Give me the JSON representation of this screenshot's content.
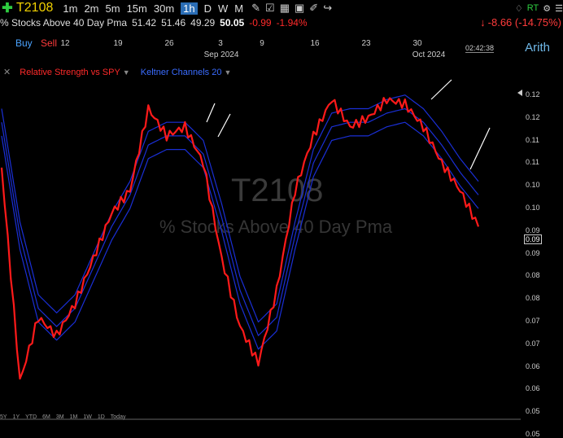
{
  "toolbar": {
    "symbol": "T2108",
    "timeframes": [
      "1m",
      "2m",
      "5m",
      "15m",
      "30m",
      "1h",
      "D",
      "W",
      "M"
    ],
    "active_timeframe": "1h",
    "rt_label": "RT"
  },
  "quote": {
    "title": "% Stocks Above 40 Day Pma",
    "open": "51.42",
    "high": "51.46",
    "low": "49.29",
    "last": "50.05",
    "change": "-0.99",
    "change_pct": "-1.94%",
    "right_change": "-8.66",
    "right_change_pct": "(-14.75%)"
  },
  "trade": {
    "buy": "Buy",
    "sell": "Sell"
  },
  "scale_mode": "Arith",
  "clock": "02:42:38",
  "date_axis": {
    "ticks": [
      "12",
      "19",
      "26",
      "3",
      "9",
      "16",
      "23",
      "30"
    ],
    "months": [
      "Sep 2024",
      "Oct 2024"
    ]
  },
  "legend": {
    "study1": "Relative Strength vs SPY",
    "study2": "Keltner Channels 20"
  },
  "watermark": {
    "symbol": "T2108",
    "description": "% Stocks Above 40 Day Pma"
  },
  "ranges": [
    "5Y",
    "1Y",
    "YTD",
    "6M",
    "3M",
    "1M",
    "1W",
    "1D",
    "Today"
  ],
  "colors": {
    "price": "#ff1a1a",
    "keltner": "#1a2fd6",
    "symbol": "#f0d000",
    "buy": "#4aa3ff",
    "sell": "#ff3b3b"
  },
  "chart_data": {
    "type": "line",
    "title": "% Stocks Above 40 Day Pma",
    "series": [
      {
        "name": "Relative Strength vs SPY",
        "x": [
          "Aug 7",
          "Aug 9",
          "Aug 12",
          "Aug 14",
          "Aug 16",
          "Aug 19",
          "Aug 21",
          "Aug 23",
          "Aug 26",
          "Aug 28",
          "Aug 30",
          "Sep 3",
          "Sep 5",
          "Sep 9",
          "Sep 11",
          "Sep 13",
          "Sep 16",
          "Sep 18",
          "Sep 20",
          "Sep 23",
          "Sep 25",
          "Sep 27",
          "Sep 30",
          "Oct 2",
          "Oct 4",
          "Oct 7",
          "Oct 9"
        ],
        "values": [
          0.105,
          0.058,
          0.072,
          0.068,
          0.075,
          0.085,
          0.095,
          0.1,
          0.118,
          0.112,
          0.114,
          0.106,
          0.085,
          0.07,
          0.062,
          0.078,
          0.1,
          0.112,
          0.12,
          0.114,
          0.116,
          0.12,
          0.119,
          0.114,
          0.106,
          0.1,
          0.092
        ]
      },
      {
        "name": "Keltner Channels 20",
        "x": [
          "Aug 7",
          "Aug 9",
          "Aug 12",
          "Aug 14",
          "Aug 16",
          "Aug 19",
          "Aug 21",
          "Aug 23",
          "Aug 26",
          "Aug 28",
          "Aug 30",
          "Sep 3",
          "Sep 5",
          "Sep 9",
          "Sep 11",
          "Sep 13",
          "Sep 16",
          "Sep 18",
          "Sep 20",
          "Sep 23",
          "Sep 25",
          "Sep 27",
          "Sep 30",
          "Oct 2",
          "Oct 4",
          "Oct 7",
          "Oct 9"
        ],
        "values": [
          0.115,
          0.09,
          0.074,
          0.07,
          0.074,
          0.083,
          0.092,
          0.099,
          0.11,
          0.112,
          0.112,
          0.108,
          0.094,
          0.078,
          0.068,
          0.072,
          0.09,
          0.106,
          0.114,
          0.115,
          0.115,
          0.117,
          0.118,
          0.115,
          0.11,
          0.104,
          0.099
        ]
      }
    ],
    "y_ticks": [
      "0.12",
      "0.12",
      "0.11",
      "0.11",
      "0.10",
      "0.10",
      "0.09",
      "0.09",
      "0.08",
      "0.08",
      "0.07",
      "0.07",
      "0.06",
      "0.06",
      "0.05",
      "0.05"
    ],
    "current_value": "0.09",
    "ylim": [
      0.051,
      0.124
    ],
    "grid": false
  }
}
